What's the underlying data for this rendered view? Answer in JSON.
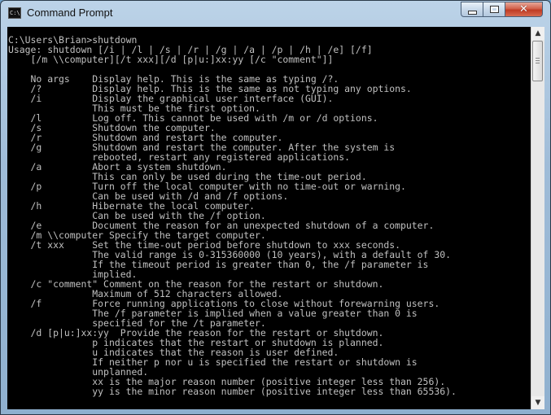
{
  "window": {
    "title": "Command Prompt",
    "icon": "console-icon",
    "icon_text": "C:\\"
  },
  "controls": {
    "minimize_icon": "minimize-icon",
    "maximize_icon": "maximize-icon",
    "close_icon": "close-icon",
    "close_glyph": "✕"
  },
  "console": {
    "lines": [
      "C:\\Users\\Brian>shutdown",
      "Usage: shutdown [/i | /l | /s | /r | /g | /a | /p | /h | /e] [/f]",
      "    [/m \\\\computer][/t xxx][/d [p|u:]xx:yy [/c \"comment\"]]",
      "",
      "    No args    Display help. This is the same as typing /?.",
      "    /?         Display help. This is the same as not typing any options.",
      "    /i         Display the graphical user interface (GUI).",
      "               This must be the first option.",
      "    /l         Log off. This cannot be used with /m or /d options.",
      "    /s         Shutdown the computer.",
      "    /r         Shutdown and restart the computer.",
      "    /g         Shutdown and restart the computer. After the system is",
      "               rebooted, restart any registered applications.",
      "    /a         Abort a system shutdown.",
      "               This can only be used during the time-out period.",
      "    /p         Turn off the local computer with no time-out or warning.",
      "               Can be used with /d and /f options.",
      "    /h         Hibernate the local computer.",
      "               Can be used with the /f option.",
      "    /e         Document the reason for an unexpected shutdown of a computer.",
      "    /m \\\\computer Specify the target computer.",
      "    /t xxx     Set the time-out period before shutdown to xxx seconds.",
      "               The valid range is 0-315360000 (10 years), with a default of 30.",
      "               If the timeout period is greater than 0, the /f parameter is",
      "               implied.",
      "    /c \"comment\" Comment on the reason for the restart or shutdown.",
      "               Maximum of 512 characters allowed.",
      "    /f         Force running applications to close without forewarning users.",
      "               The /f parameter is implied when a value greater than 0 is",
      "               specified for the /t parameter.",
      "    /d [p|u:]xx:yy  Provide the reason for the restart or shutdown.",
      "               p indicates that the restart or shutdown is planned.",
      "               u indicates that the reason is user defined.",
      "               If neither p nor u is specified the restart or shutdown is",
      "               unplanned.",
      "               xx is the major reason number (positive integer less than 256).",
      "               yy is the minor reason number (positive integer less than 65536)."
    ]
  },
  "scrollbar": {
    "up_icon": "scroll-up-arrow-icon",
    "down_icon": "scroll-down-arrow-icon",
    "up_glyph": "▲",
    "down_glyph": "▼",
    "scroll_position": 0.0
  },
  "colors": {
    "console_bg": "#000000",
    "console_text": "#c0c0c0",
    "close_button": "#c9432b"
  }
}
